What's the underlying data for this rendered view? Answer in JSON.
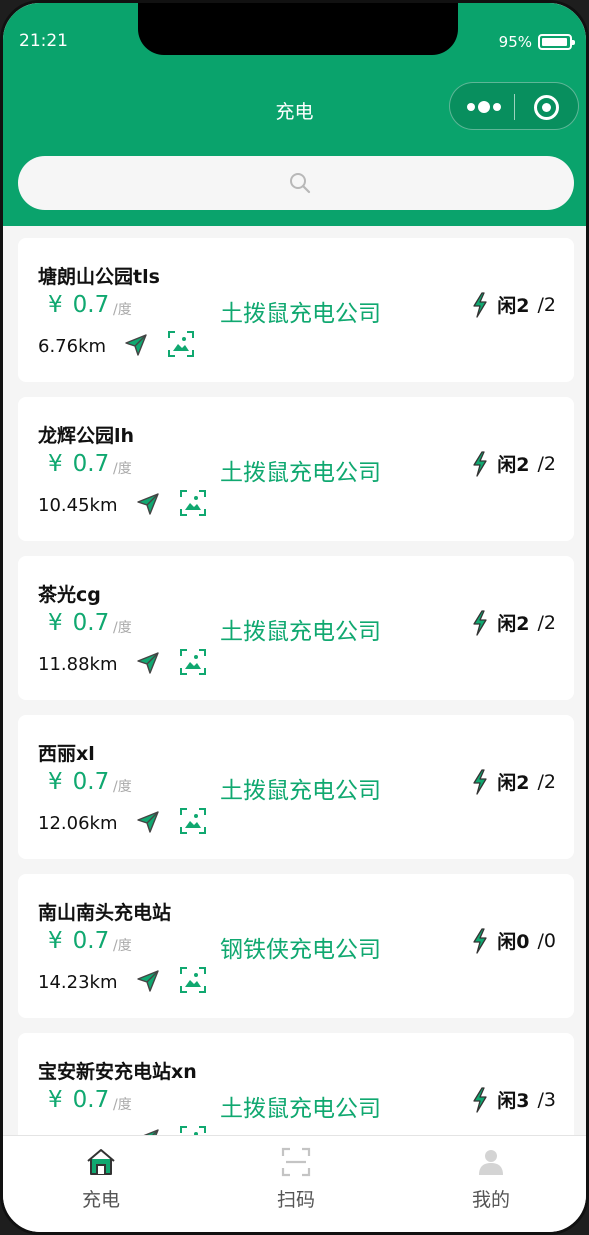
{
  "status_bar": {
    "time": "21:21",
    "battery": "95%"
  },
  "header": {
    "title": "充电"
  },
  "search": {
    "placeholder": ""
  },
  "colors": {
    "primary": "#0aa36c",
    "accent_text": "#10a870"
  },
  "stations": [
    {
      "name": "塘朗山公园tls",
      "yen": "¥",
      "price": "0.7",
      "unit": "/度",
      "company": "土拨鼠充电公司",
      "idle_label": "闲2",
      "total": "/2",
      "distance": "6.76km"
    },
    {
      "name": "龙辉公园lh",
      "yen": "¥",
      "price": "0.7",
      "unit": "/度",
      "company": "土拨鼠充电公司",
      "idle_label": "闲2",
      "total": "/2",
      "distance": "10.45km"
    },
    {
      "name": "茶光cg",
      "yen": "¥",
      "price": "0.7",
      "unit": "/度",
      "company": "土拨鼠充电公司",
      "idle_label": "闲2",
      "total": "/2",
      "distance": "11.88km"
    },
    {
      "name": "西丽xl",
      "yen": "¥",
      "price": "0.7",
      "unit": "/度",
      "company": "土拨鼠充电公司",
      "idle_label": "闲2",
      "total": "/2",
      "distance": "12.06km"
    },
    {
      "name": "南山南头充电站",
      "yen": "¥",
      "price": "0.7",
      "unit": "/度",
      "company": "钢铁侠充电公司",
      "idle_label": "闲0",
      "total": "/0",
      "distance": "14.23km"
    },
    {
      "name": "宝安新安充电站xn",
      "yen": "¥",
      "price": "0.7",
      "unit": "/度",
      "company": "土拨鼠充电公司",
      "idle_label": "闲3",
      "total": "/3",
      "distance": ""
    }
  ],
  "tabbar": {
    "items": [
      {
        "label": "充电",
        "icon": "home-icon"
      },
      {
        "label": "扫码",
        "icon": "scan-icon"
      },
      {
        "label": "我的",
        "icon": "user-icon"
      }
    ]
  }
}
